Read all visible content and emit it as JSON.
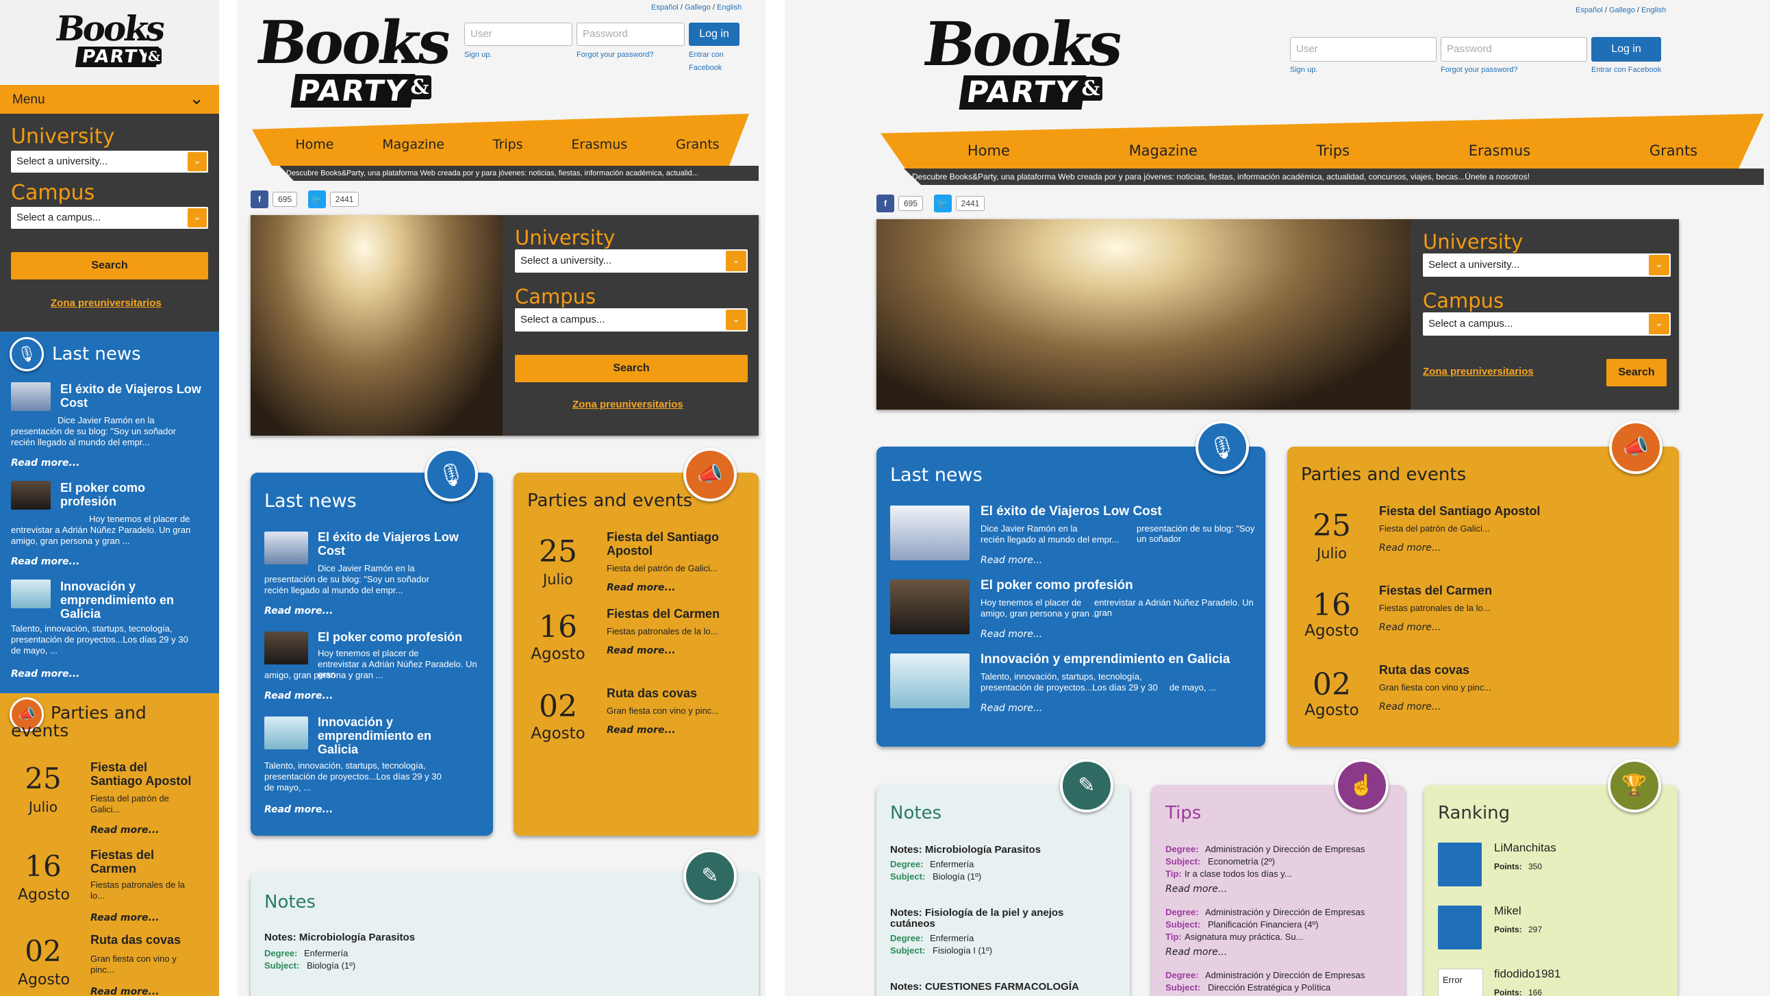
{
  "brand": {
    "logo_word_1": "Books",
    "logo_word_2": "PARTY",
    "logo_amp": "&"
  },
  "languages": {
    "es": "Español",
    "sep1": " / ",
    "gl": "Gallego",
    "sep2": " / ",
    "en": "English"
  },
  "login": {
    "user_placeholder": "User",
    "password_placeholder": "Password",
    "login_label": "Log in",
    "signup": "Sign up.",
    "forgot": "Forgot your password?",
    "facebook": "Entrar con Facebook",
    "facebook_1": "Entrar con",
    "facebook_2": "Facebook"
  },
  "nav": {
    "items": [
      "Home",
      "Magazine",
      "Trips",
      "Erasmus",
      "Grants"
    ]
  },
  "ticker": {
    "full": "Descubre Books&Party, una plataforma Web creada por y para jóvenes: noticias, fiestas, información académica, actualidad, concursos, viajes, becas...Únete a nosotros!",
    "short": "Descubre Books&Party, una plataforma Web creada por y para jóvenes: noticias, fiestas, información académica, actualid..."
  },
  "social": {
    "fb_count": "695",
    "tw_count": "2441",
    "fb_icon": "f",
    "tw_icon": "🐦"
  },
  "mobile_menu": {
    "label": "Menu",
    "chevron": "⌄"
  },
  "search": {
    "university_label": "University",
    "university_placeholder": "Select a university...",
    "campus_label": "Campus",
    "campus_placeholder": "Select a campus...",
    "search_label": "Search",
    "preuni_link": "Zona preuniversitarios",
    "arrow": "⌄"
  },
  "sections": {
    "last_news": "Last news",
    "parties": "Parties and events",
    "parties_1": "Parties and",
    "parties_2": "events",
    "notes": "Notes",
    "tips": "Tips",
    "ranking": "Ranking"
  },
  "icons": {
    "mic": "🎙",
    "megaphone": "📣",
    "pencil": "✎",
    "tip": "☝",
    "trophy": "🏆"
  },
  "news": [
    {
      "title": "El éxito de Viajeros Low Cost",
      "title_1": "El éxito de Viajeros Low",
      "title_2": "Cost",
      "body": "Dice Javier Ramón en la presentación de su blog: \"Soy un soñador recién llegado al mundo del empr...",
      "body_1": "Dice Javier Ramón en la",
      "body_2": "presentación de su blog: \"Soy un soñador",
      "body_3": "recién llegado al mundo del empr..."
    },
    {
      "title": "El poker como profesión",
      "title_1": "El poker como",
      "title_2": "profesión",
      "body": "Hoy tenemos el placer de entrevistar a Adrián Núñez Paradelo. Un gran amigo, gran persona y gran ...",
      "body_1": "Hoy tenemos el placer de",
      "body_2": "entrevistar a Adrián Núñez Paradelo. Un gran",
      "body_3": "amigo, gran persona y gran ..."
    },
    {
      "title": "Innovación y emprendimiento en Galicia",
      "title_1": "Innovación y",
      "title_2": "emprendimiento en",
      "title_3": "Galicia",
      "body": "Talento, innovación, startups, tecnología, presentación de proyectos...Los días 29 y 30 de mayo, ...",
      "body_1": "Talento, innovación, startups, tecnología,",
      "body_2": "presentación de proyectos...Los días 29 y 30",
      "body_3": "de mayo, ..."
    }
  ],
  "read_more": "Read more...",
  "events": [
    {
      "day": "25",
      "month": "Julio",
      "title": "Fiesta del Santiago Apostol",
      "title_1": "Fiesta del Santiago",
      "title_2": "Apostol",
      "title_m1": "Fiesta del",
      "title_m2": "Santiago Apostol",
      "desc": "Fiesta del patrón de Galici...",
      "desc_1": "Fiesta del patrón de",
      "desc_2": "Galici..."
    },
    {
      "day": "16",
      "month": "Agosto",
      "title": "Fiestas del Carmen",
      "title_m1": "Fiestas del",
      "title_m2": "Carmen",
      "desc": "Fiestas patronales de la lo...",
      "desc_1": "Fiestas patronales de la",
      "desc_2": "lo..."
    },
    {
      "day": "02",
      "month": "Agosto",
      "title": "Ruta das covas",
      "title_m1": "Ruta das covas",
      "desc": "Gran fiesta con vino y pinc...",
      "desc_1": "Gran fiesta con vino y",
      "desc_2": "pinc..."
    }
  ],
  "notes": [
    {
      "title": "Notes: Microbiología Parasitos",
      "degree_label": "Degree:",
      "degree": "Enfermería",
      "subject_label": "Subject:",
      "subject": "Biología (1º)"
    },
    {
      "title": "Notes: Fisiología de la piel y anejos cutáneos",
      "title_1": "Notes: Fisiología de la piel y anejos",
      "title_2": "cutáneos",
      "degree_label": "Degree:",
      "degree": "Enfermería",
      "subject_label": "Subject:",
      "subject": "Fisiología I (1º)"
    },
    {
      "title": "Notes: CUESTIONES FARMACOLOGÍA"
    }
  ],
  "tips": [
    {
      "degree_label": "Degree:",
      "degree": "Administración y Dirección de Empresas",
      "subject_label": "Subject:",
      "subject": "Econometría (2º)",
      "tip_label": "Tip:",
      "tip": "Ir a clase todos los días y..."
    },
    {
      "degree_label": "Degree:",
      "degree": "Administración y Dirección de Empresas",
      "subject_label": "Subject:",
      "subject": "Planificación Financiera (4º)",
      "tip_label": "Tip:",
      "tip": "Asignatura muy práctica. Su..."
    },
    {
      "degree_label": "Degree:",
      "degree": "Administración y Dirección de Empresas",
      "subject_label": "Subject:",
      "subject": "Dirección Estratégica y Política"
    }
  ],
  "ranking": [
    {
      "name": "LiManchitas",
      "points_label": "Points:",
      "points": "350"
    },
    {
      "name": "Mikel",
      "points_label": "Points:",
      "points": "297"
    },
    {
      "name": "fidodido1981",
      "points_label": "Points:",
      "points": "166",
      "avatar_alt": "Error"
    }
  ],
  "colors": {
    "orange": "#f39c12",
    "blue": "#1f6fb9",
    "gold": "#e7a422",
    "dark": "#3a3a3a"
  }
}
